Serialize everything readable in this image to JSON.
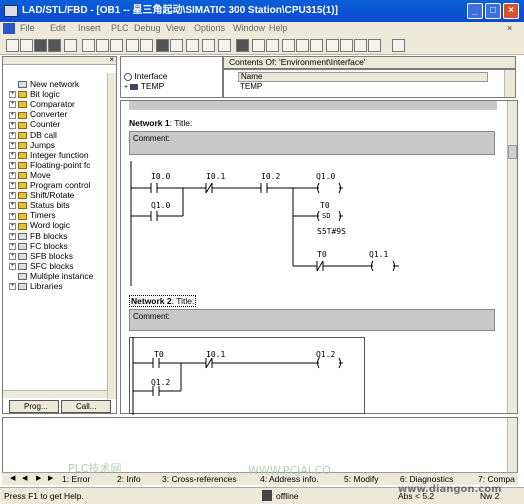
{
  "window": {
    "title": "LAD/STL/FBD  - [OB1 -- 星三角起动\\SIMATIC 300 Station\\CPU315(1)]",
    "min": "_",
    "max": "□",
    "close": "×"
  },
  "menu": [
    "File",
    "Edit",
    "Insert",
    "PLC",
    "Debug",
    "View",
    "Options",
    "Window",
    "Help"
  ],
  "catalog": {
    "items": [
      {
        "label": "New network",
        "expand": "",
        "icon": "box"
      },
      {
        "label": "Bit logic",
        "expand": "+",
        "icon": "folder"
      },
      {
        "label": "Comparator",
        "expand": "+",
        "icon": "folder"
      },
      {
        "label": "Converter",
        "expand": "+",
        "icon": "folder"
      },
      {
        "label": "Counter",
        "expand": "+",
        "icon": "folder"
      },
      {
        "label": "DB call",
        "expand": "+",
        "icon": "folder"
      },
      {
        "label": "Jumps",
        "expand": "+",
        "icon": "folder"
      },
      {
        "label": "Integer function",
        "expand": "+",
        "icon": "folder"
      },
      {
        "label": "Floating-point fc",
        "expand": "+",
        "icon": "folder"
      },
      {
        "label": "Move",
        "expand": "+",
        "icon": "folder"
      },
      {
        "label": "Program control",
        "expand": "+",
        "icon": "folder"
      },
      {
        "label": "Shift/Rotate",
        "expand": "+",
        "icon": "folder"
      },
      {
        "label": "Status bits",
        "expand": "+",
        "icon": "folder"
      },
      {
        "label": "Timers",
        "expand": "+",
        "icon": "folder"
      },
      {
        "label": "Word logic",
        "expand": "+",
        "icon": "folder"
      },
      {
        "label": "FB blocks",
        "expand": "+",
        "icon": "box"
      },
      {
        "label": "FC blocks",
        "expand": "+",
        "icon": "box"
      },
      {
        "label": "SFB blocks",
        "expand": "+",
        "icon": "box"
      },
      {
        "label": "SFC blocks",
        "expand": "+",
        "icon": "box"
      },
      {
        "label": "Multiple instance",
        "expand": "",
        "icon": "box"
      },
      {
        "label": "Libraries",
        "expand": "+",
        "icon": "box"
      }
    ],
    "tab_prog": "Prog...",
    "tab_call": "Call..."
  },
  "interface": {
    "root": "Interface",
    "child": "TEMP",
    "contents_title": "Contents Of: 'Environment\\Interface'",
    "col_name": "Name",
    "row1": "TEMP"
  },
  "editor": {
    "network1": {
      "label": "Network 1",
      "title": ": Title:",
      "comment": "Comment:"
    },
    "network2": {
      "label": "Network 2",
      "title": ": Title:",
      "comment": "Comment:"
    },
    "n1": {
      "c1": "I0.0",
      "c2": "I0.1",
      "c3": "I0.2",
      "coil1": "Q1.0",
      "par": "Q1.0",
      "timer": "T0",
      "timer_type": "SD",
      "timer_val": "S5T#9S",
      "t0c": "T0",
      "coil2": "Q1.1"
    },
    "n2": {
      "c1": "T0",
      "c2": "I0.1",
      "coil": "Q1.2",
      "par": "Q1.2"
    }
  },
  "tabs": [
    "1: Error",
    "2: Info",
    "3: Cross-references",
    "4: Address info.",
    "5: Modify",
    "6: Diagnostics",
    "7: Compa"
  ],
  "status": {
    "help": "Press F1 to get Help.",
    "mode": "offline",
    "abs": "Abs < 5.2",
    "nw": "Nw 2"
  },
  "watermark": {
    "left": "PLC技术网",
    "url": "WWW.PCJAI.CO",
    "site": "www.diangon.com"
  }
}
